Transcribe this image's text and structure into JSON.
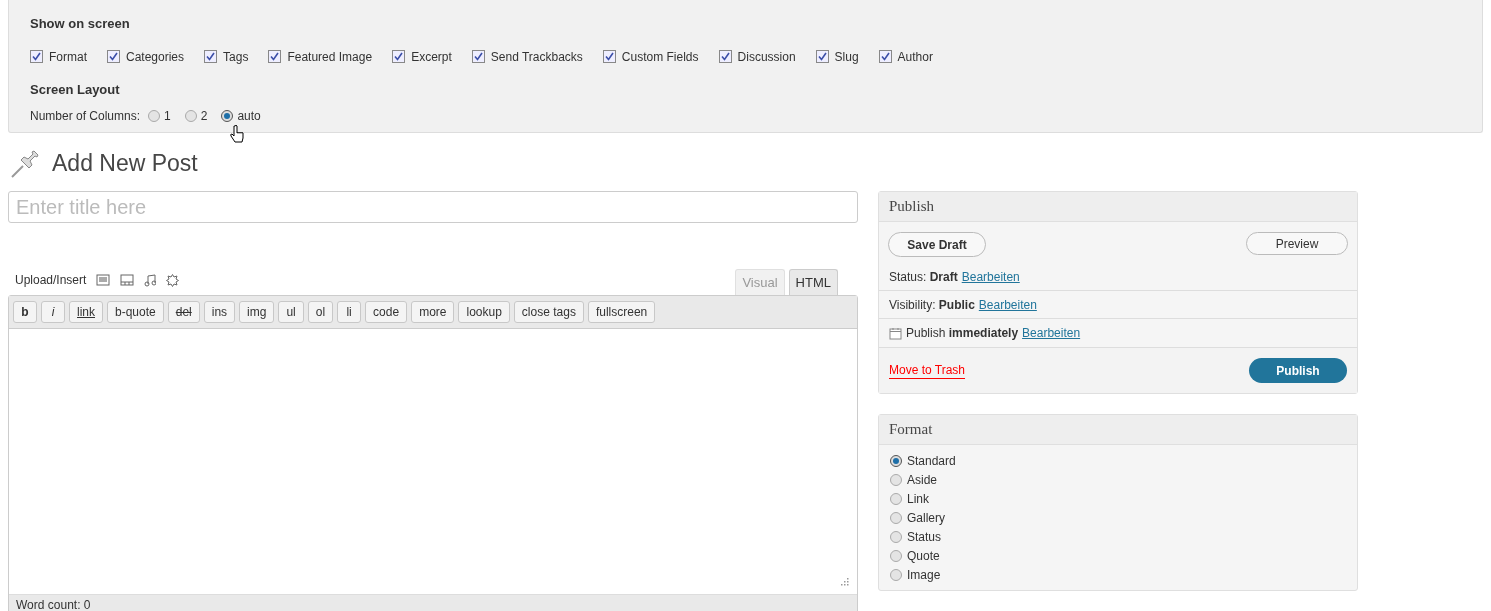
{
  "screen_options": {
    "title": "Show on screen",
    "checkboxes": [
      {
        "label": "Format",
        "checked": true
      },
      {
        "label": "Categories",
        "checked": true
      },
      {
        "label": "Tags",
        "checked": true
      },
      {
        "label": "Featured Image",
        "checked": true
      },
      {
        "label": "Excerpt",
        "checked": true
      },
      {
        "label": "Send Trackbacks",
        "checked": true
      },
      {
        "label": "Custom Fields",
        "checked": true
      },
      {
        "label": "Discussion",
        "checked": true
      },
      {
        "label": "Slug",
        "checked": true
      },
      {
        "label": "Author",
        "checked": true
      }
    ],
    "layout_title": "Screen Layout",
    "columns_label": "Number of Columns:",
    "columns": [
      {
        "label": "1",
        "selected": false
      },
      {
        "label": "2",
        "selected": false
      },
      {
        "label": "auto",
        "selected": true
      }
    ]
  },
  "page_title": "Add New Post",
  "title_field": {
    "placeholder": "Enter title here"
  },
  "editor": {
    "upload_label": "Upload/Insert",
    "tabs": [
      {
        "label": "Visual",
        "selected": false
      },
      {
        "label": "HTML",
        "selected": true
      }
    ],
    "quicktags": [
      {
        "label": "b",
        "kind": "bold"
      },
      {
        "label": "i",
        "kind": "italic"
      },
      {
        "label": "link",
        "kind": "underline"
      },
      {
        "label": "b-quote",
        "kind": "plain"
      },
      {
        "label": "del",
        "kind": "strike"
      },
      {
        "label": "ins",
        "kind": "plain"
      },
      {
        "label": "img",
        "kind": "plain"
      },
      {
        "label": "ul",
        "kind": "plain"
      },
      {
        "label": "ol",
        "kind": "plain"
      },
      {
        "label": "li",
        "kind": "plain"
      },
      {
        "label": "code",
        "kind": "plain"
      },
      {
        "label": "more",
        "kind": "plain"
      },
      {
        "label": "lookup",
        "kind": "plain"
      },
      {
        "label": "close tags",
        "kind": "plain"
      },
      {
        "label": "fullscreen",
        "kind": "plain"
      }
    ],
    "word_count": "Word count: 0"
  },
  "publish": {
    "title": "Publish",
    "save_draft": "Save Draft",
    "preview": "Preview",
    "rows": [
      {
        "kind": "text",
        "text": "Status: **Draft**",
        "link": "Bearbeiten"
      },
      {
        "kind": "text",
        "text": "Visibility: **Public**",
        "link": "Bearbeiten"
      },
      {
        "kind": "calendar",
        "text": "Publish **immediately**",
        "link": "Bearbeiten"
      }
    ],
    "trash": "Move to Trash",
    "publish_button": "Publish"
  },
  "format": {
    "title": "Format",
    "options": [
      {
        "label": "Standard",
        "selected": true
      },
      {
        "label": "Aside",
        "selected": false
      },
      {
        "label": "Link",
        "selected": false
      },
      {
        "label": "Gallery",
        "selected": false
      },
      {
        "label": "Status",
        "selected": false
      },
      {
        "label": "Quote",
        "selected": false
      },
      {
        "label": "Image",
        "selected": false
      }
    ]
  }
}
